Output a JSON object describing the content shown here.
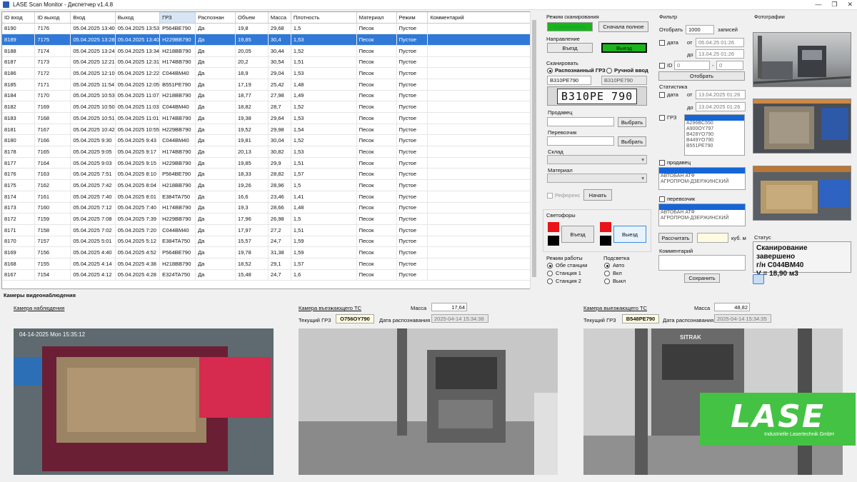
{
  "window": {
    "title": "LASE Scan Monitor - Диспетчер v1.4.8"
  },
  "table": {
    "columns": [
      "ID вход",
      "ID выход",
      "Вход",
      "Выход",
      "ГРЗ",
      "Распознан",
      "Объем",
      "Масса",
      "Плотность",
      "Материал",
      "Режим",
      "Комментарий"
    ],
    "rows": [
      [
        "8190",
        "7176",
        "05.04.2025 13:40",
        "05.04.2025 13:53",
        "P564BE790",
        "Да",
        "19,8",
        "29,68",
        "1,5",
        "Песок",
        "Пустое",
        ""
      ],
      [
        "8189",
        "7175",
        "05.04.2025 13:28",
        "05.04.2025 13:40",
        "H229BB790",
        "Да",
        "19,85",
        "30,4",
        "1,53",
        "Песок",
        "Пустое",
        ""
      ],
      [
        "8188",
        "7174",
        "05.04.2025 13:24",
        "05.04.2025 13:34",
        "H218BB790",
        "Да",
        "20,05",
        "30,44",
        "1,52",
        "Песок",
        "Пустое",
        ""
      ],
      [
        "8187",
        "7173",
        "05.04.2025 12:21",
        "05.04.2025 12:31",
        "H174BB790",
        "Да",
        "20,2",
        "30,54",
        "1,51",
        "Песок",
        "Пустое",
        ""
      ],
      [
        "8186",
        "7172",
        "05.04.2025 12:10",
        "05.04.2025 12:22",
        "C044BM40",
        "Да",
        "18,9",
        "29,04",
        "1,53",
        "Песок",
        "Пустое",
        ""
      ],
      [
        "8185",
        "7171",
        "05.04.2025 11:54",
        "05.04.2025 12:05",
        "B551PE790",
        "Да",
        "17,19",
        "25,42",
        "1,48",
        "Песок",
        "Пустое",
        ""
      ],
      [
        "8184",
        "7170",
        "05.04.2025 10:53",
        "05.04.2025 11:07",
        "H218BB790",
        "Да",
        "18,77",
        "27,98",
        "1,49",
        "Песок",
        "Пустое",
        ""
      ],
      [
        "8182",
        "7169",
        "05.04.2025 10:50",
        "05.04.2025 11:03",
        "C044BM40",
        "Да",
        "18,82",
        "28,7",
        "1,52",
        "Песок",
        "Пустое",
        ""
      ],
      [
        "8183",
        "7168",
        "05.04.2025 10:51",
        "05.04.2025 11:01",
        "H174BB790",
        "Да",
        "19,38",
        "29,64",
        "1,53",
        "Песок",
        "Пустое",
        ""
      ],
      [
        "8181",
        "7167",
        "05.04.2025 10:42",
        "05.04.2025 10:55",
        "H229BB790",
        "Да",
        "19,52",
        "29,98",
        "1,54",
        "Песок",
        "Пустое",
        ""
      ],
      [
        "8180",
        "7166",
        "05.04.2025 9:30",
        "05.04.2025 9:43",
        "C044BM40",
        "Да",
        "19,81",
        "30,04",
        "1,52",
        "Песок",
        "Пустое",
        ""
      ],
      [
        "8178",
        "7165",
        "05.04.2025 9:05",
        "05.04.2025 9:17",
        "H174BB790",
        "Да",
        "20,13",
        "30,82",
        "1,53",
        "Песок",
        "Пустое",
        ""
      ],
      [
        "8177",
        "7164",
        "05.04.2025 9:03",
        "05.04.2025 9:15",
        "H229BB790",
        "Да",
        "19,85",
        "29,9",
        "1,51",
        "Песок",
        "Пустое",
        ""
      ],
      [
        "8176",
        "7163",
        "05.04.2025 7:51",
        "05.04.2025 8:10",
        "P564BE790",
        "Да",
        "18,33",
        "28,82",
        "1,57",
        "Песок",
        "Пустое",
        ""
      ],
      [
        "8175",
        "7162",
        "05.04.2025 7:42",
        "05.04.2025 8:04",
        "H218BB790",
        "Да",
        "19,26",
        "28,96",
        "1,5",
        "Песок",
        "Пустое",
        ""
      ],
      [
        "8174",
        "7161",
        "05.04.2025 7:40",
        "05.04.2025 8:01",
        "E384TA750",
        "Да",
        "16,6",
        "23,46",
        "1,41",
        "Песок",
        "Пустое",
        ""
      ],
      [
        "8173",
        "7160",
        "05.04.2025 7:12",
        "05.04.2025 7:40",
        "H174BB790",
        "Да",
        "19,3",
        "28,66",
        "1,48",
        "Песок",
        "Пустое",
        ""
      ],
      [
        "8172",
        "7159",
        "05.04.2025 7:08",
        "05.04.2025 7:39",
        "H229BB790",
        "Да",
        "17,96",
        "26,98",
        "1,5",
        "Песок",
        "Пустое",
        ""
      ],
      [
        "8171",
        "7158",
        "05.04.2025 7:02",
        "05.04.2025 7:20",
        "C044BM40",
        "Да",
        "17,97",
        "27,2",
        "1,51",
        "Песок",
        "Пустое",
        ""
      ],
      [
        "8170",
        "7157",
        "05.04.2025 5:01",
        "05.04.2025 5:12",
        "E384TA750",
        "Да",
        "15,57",
        "24,7",
        "1,59",
        "Песок",
        "Пустое",
        ""
      ],
      [
        "8169",
        "7156",
        "05.04.2025 4:40",
        "05.04.2025 4:52",
        "P564BE790",
        "Да",
        "19,78",
        "31,38",
        "1,59",
        "Песок",
        "Пустое",
        ""
      ],
      [
        "8168",
        "7155",
        "05.04.2025 4:14",
        "05.04.2025 4:38",
        "H218BB790",
        "Да",
        "18,52",
        "29,1",
        "1,57",
        "Песок",
        "Пустое",
        ""
      ],
      [
        "8167",
        "7154",
        "05.04.2025 4:12",
        "05.04.2025 4:28",
        "E324TA750",
        "Да",
        "15,48",
        "24,7",
        "1,6",
        "Песок",
        "Пустое",
        ""
      ]
    ],
    "selected_row": 1
  },
  "scan": {
    "mode_label": "Режим сканирования",
    "btn_scan_full": "Сканировать",
    "btn_full_first": "Сначала полное",
    "direction_label": "Направление",
    "btn_entry": "Въезд",
    "btn_exit": "Выезд",
    "scan_label": "Сканировать",
    "radio_recognized": "Распознанный ГРЗ",
    "radio_manual": "Ручной ввод",
    "plate_value": "B310PE790",
    "plate_value2": "B310PE790",
    "plate_image_text": "B310PE 790",
    "seller_label": "Продавец",
    "carrier_label": "Перевозчик",
    "btn_choose": "Выбрать",
    "warehouse_label": "Склад",
    "material_label": "Материал",
    "reference_label": "Референс",
    "btn_start": "Начать",
    "traffic_label": "Светофоры",
    "btn_light_entry": "Въезд",
    "btn_light_exit": "Выезд",
    "work_mode_label": "Режим работы",
    "work_modes": [
      "Обе станции",
      "Станция 1",
      "Станция 2"
    ],
    "light_label": "Подсветка",
    "light_modes": [
      "Авто",
      "Вкл",
      "Выкл"
    ]
  },
  "filter": {
    "label": "Фильтр",
    "show_label": "Отобрать",
    "count": "1000",
    "records_label": "записей",
    "date_label": "дата",
    "from_label": "от",
    "to_label": "до",
    "from_date": "05.04.25 01:26",
    "to_date": "13.04.25 01:26",
    "id_label": "ID",
    "id_from": "0",
    "id_dash": "-",
    "id_to": "0",
    "btn_select": "Отобрать"
  },
  "stats": {
    "label": "Статистика",
    "date_label": "дата",
    "from_label": "от",
    "to_label": "до",
    "from_date": "13.04.2025 01:26",
    "to_date": "13.04.2025 01:26",
    "grz_label": "ГРЗ",
    "grz_list": [
      "A296BC550",
      "A900OY797",
      "B428YO790",
      "B449YO790",
      "B551PE790"
    ],
    "seller_label": "продавец",
    "seller_list": [
      "АВТОБАН АТФ",
      "АГРОПРОМ-ДЗЕРЖИНСКИЙ"
    ],
    "carrier_label": "перевозчик",
    "carrier_list": [
      "АВТОБАН АТФ",
      "АГРОПРОМ-ДЗЕРЖИНСКИЙ"
    ],
    "btn_calc": "Рассчитать",
    "unit": "куб. м",
    "comment_label": "Комментарий",
    "btn_save": "Сохранить"
  },
  "photos": {
    "label": "Фотографии"
  },
  "status": {
    "label": "Статус",
    "line1": "Сканирование завершено",
    "line2": "г/н C044BM40",
    "line3": "V = 18,90 м3"
  },
  "cameras": {
    "section_label": "Камеры видеонаблюдения",
    "observation_label": "Камера наблюдения",
    "observation_ts": "04-14-2025 Mon 15:35:12",
    "entry_label": "Камера въезжающего ТС",
    "entry_mass_label": "Масса",
    "entry_mass": "17,64",
    "entry_grz_label": "Текущий ГРЗ",
    "entry_grz": "O756OY790",
    "entry_date_label": "Дата распознавания",
    "entry_date": "2025-04-14 15:34:38",
    "exit_label": "Камера выезжающего ТС",
    "exit_mass_label": "Масса",
    "exit_mass": "48,82",
    "exit_grz_label": "Текущий ГРЗ",
    "exit_grz": "B548PE790",
    "exit_date_label": "Дата распознавания",
    "exit_date": "2025-04-14 15:34:35",
    "truck_brand": "SITRAK"
  },
  "logo": {
    "name": "LASE",
    "subtitle": "Industrielle Lasertechnik GmbH"
  },
  "colors": {
    "selected_row": "#3079d8",
    "active_green": "#1bb41b",
    "logo_green": "#44c244",
    "traffic_red": "#e8141a"
  }
}
